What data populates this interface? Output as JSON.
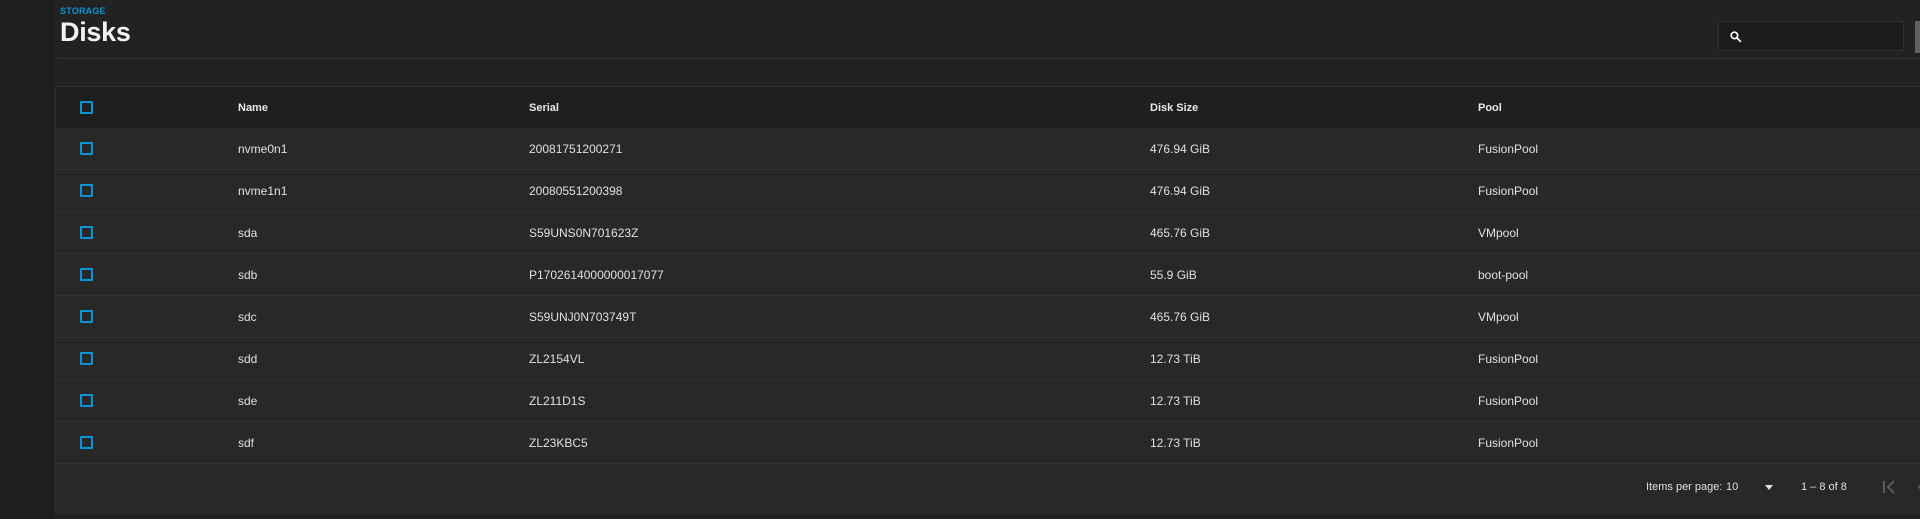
{
  "header": {
    "breadcrumb": "STORAGE",
    "title": "Disks",
    "search_placeholder": ""
  },
  "table": {
    "columns": [
      "Name",
      "Serial",
      "Disk Size",
      "Pool"
    ],
    "rows": [
      {
        "name": "nvme0n1",
        "serial": "20081751200271",
        "size": "476.94 GiB",
        "pool": "FusionPool"
      },
      {
        "name": "nvme1n1",
        "serial": "20080551200398",
        "size": "476.94 GiB",
        "pool": "FusionPool"
      },
      {
        "name": "sda",
        "serial": "S59UNS0N701623Z",
        "size": "465.76 GiB",
        "pool": "VMpool"
      },
      {
        "name": "sdb",
        "serial": "P1702614000000017077",
        "size": "55.9 GiB",
        "pool": "boot-pool"
      },
      {
        "name": "sdc",
        "serial": "S59UNJ0N703749T",
        "size": "465.76 GiB",
        "pool": "VMpool"
      },
      {
        "name": "sdd",
        "serial": "ZL2154VL",
        "size": "12.73 TiB",
        "pool": "FusionPool"
      },
      {
        "name": "sde",
        "serial": "ZL211D1S",
        "size": "12.73 TiB",
        "pool": "FusionPool"
      },
      {
        "name": "sdf",
        "serial": "ZL23KBC5",
        "size": "12.73 TiB",
        "pool": "FusionPool"
      }
    ]
  },
  "paginator": {
    "items_per_page_label": "Items per page:",
    "items_per_page_value": "10",
    "range_label": "1 – 8 of 8"
  },
  "colors": {
    "accent": "#0a95d8",
    "background": "#222222",
    "row_background": "#282828",
    "header_background": "#1f1f1f"
  },
  "icons": {
    "search": "search-icon",
    "dropdown": "chevron-down-icon",
    "first_page": "first-page-icon",
    "prev_page": "chevron-left-icon"
  }
}
